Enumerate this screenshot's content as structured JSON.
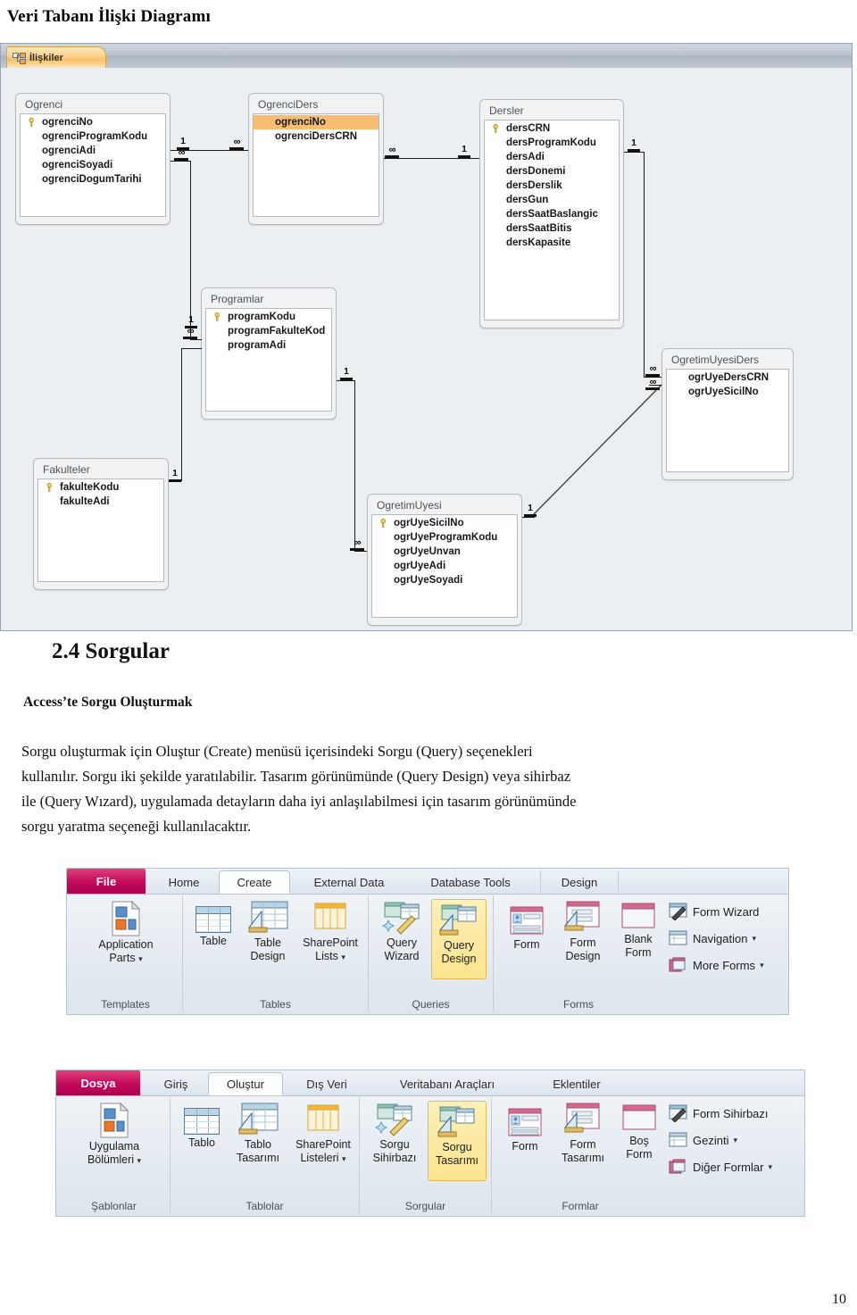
{
  "page": {
    "title": "Veri Tabanı İlişki Diagramı",
    "number": "10"
  },
  "access_window": {
    "tab_label": "İlişkiler",
    "tab_icon": "relationships-icon"
  },
  "er_diagram": {
    "tables": [
      {
        "name": "Ogrenci",
        "fields": [
          {
            "label": "ogrenciNo",
            "key": true,
            "selected": false
          },
          {
            "label": "ogrenciProgramKodu",
            "key": false,
            "selected": false
          },
          {
            "label": "ogrenciAdi",
            "key": false,
            "selected": false
          },
          {
            "label": "ogrenciSoyadi",
            "key": false,
            "selected": false
          },
          {
            "label": "ogrenciDogumTarihi",
            "key": false,
            "selected": false
          }
        ]
      },
      {
        "name": "OgrenciDers",
        "fields": [
          {
            "label": "ogrenciNo",
            "key": false,
            "selected": true
          },
          {
            "label": "ogrenciDersCRN",
            "key": false,
            "selected": false
          }
        ]
      },
      {
        "name": "Dersler",
        "fields": [
          {
            "label": "dersCRN",
            "key": true,
            "selected": false
          },
          {
            "label": "dersProgramKodu",
            "key": false,
            "selected": false
          },
          {
            "label": "dersAdi",
            "key": false,
            "selected": false
          },
          {
            "label": "dersDonemi",
            "key": false,
            "selected": false
          },
          {
            "label": "dersDerslik",
            "key": false,
            "selected": false
          },
          {
            "label": "dersGun",
            "key": false,
            "selected": false
          },
          {
            "label": "dersSaatBaslangic",
            "key": false,
            "selected": false
          },
          {
            "label": "dersSaatBitis",
            "key": false,
            "selected": false
          },
          {
            "label": "dersKapasite",
            "key": false,
            "selected": false
          }
        ]
      },
      {
        "name": "Programlar",
        "fields": [
          {
            "label": "programKodu",
            "key": true,
            "selected": false
          },
          {
            "label": "programFakulteKod",
            "key": false,
            "selected": false
          },
          {
            "label": "programAdi",
            "key": false,
            "selected": false
          }
        ]
      },
      {
        "name": "OgretimUyesiDers",
        "fields": [
          {
            "label": "ogrUyeDersCRN",
            "key": false,
            "selected": false
          },
          {
            "label": "ogrUyeSicilNo",
            "key": false,
            "selected": false
          }
        ]
      },
      {
        "name": "Fakulteler",
        "fields": [
          {
            "label": "fakulteKodu",
            "key": true,
            "selected": false
          },
          {
            "label": "fakulteAdi",
            "key": false,
            "selected": false
          }
        ]
      },
      {
        "name": "OgretimUyesi",
        "fields": [
          {
            "label": "ogrUyeSicilNo",
            "key": true,
            "selected": false
          },
          {
            "label": "ogrUyeProgramKodu",
            "key": false,
            "selected": false
          },
          {
            "label": "ogrUyeUnvan",
            "key": false,
            "selected": false
          },
          {
            "label": "ogrUyeAdi",
            "key": false,
            "selected": false
          },
          {
            "label": "ogrUyeSoyadi",
            "key": false,
            "selected": false
          }
        ]
      }
    ],
    "cardinality_one": "1",
    "cardinality_many": "∞",
    "relationships": [
      {
        "from": "Ogrenci.ogrenciNo",
        "to": "OgrenciDers.ogrenciNo",
        "from_card": "1",
        "to_card": "∞"
      },
      {
        "from": "OgrenciDers.ogrenciDersCRN",
        "to": "Dersler.dersCRN",
        "from_card": "∞",
        "to_card": "1"
      },
      {
        "from": "Programlar.programKodu",
        "to": "Ogrenci.ogrenciProgramKodu",
        "from_card": "1",
        "to_card": "∞"
      },
      {
        "from": "Fakulteler.fakulteKodu",
        "to": "Programlar.programFakulteKod",
        "from_card": "1",
        "to_card": "∞"
      },
      {
        "from": "Programlar.programKodu",
        "to": "OgretimUyesi.ogrUyeProgramKodu",
        "from_card": "1",
        "to_card": "∞"
      },
      {
        "from": "Dersler.dersCRN",
        "to": "OgretimUyesiDers.ogrUyeDersCRN",
        "from_card": "1",
        "to_card": "∞"
      },
      {
        "from": "OgretimUyesi.ogrUyeSicilNo",
        "to": "OgretimUyesiDers.ogrUyeSicilNo",
        "from_card": "1",
        "to_card": "∞"
      }
    ]
  },
  "section": {
    "heading": "2.4 Sorgular",
    "subheading": "Access’te Sorgu Oluşturmak",
    "paragraph_lines": [
      "Sorgu oluşturmak için Oluştur (Create) menüsü içerisindeki Sorgu (Query) seçenekleri",
      "kullanılır. Sorgu iki şekilde yaratılabilir. Tasarım görünümünde (Query Design) veya sihirbaz",
      "ile (Query Wızard), uygulamada detayların daha iyi anlaşılabilmesi için tasarım görünümünde",
      "sorgu yaratma seçeneği kullanılacaktır."
    ]
  },
  "ribbon_en": {
    "tabs": [
      {
        "label": "File",
        "kind": "file"
      },
      {
        "label": "Home",
        "kind": "normal"
      },
      {
        "label": "Create",
        "kind": "active"
      },
      {
        "label": "External Data",
        "kind": "normal"
      },
      {
        "label": "Database Tools",
        "kind": "normal"
      },
      {
        "label": "Design",
        "kind": "contextual"
      }
    ],
    "groups": [
      {
        "label": "Templates",
        "buttons": [
          {
            "label_line1": "Application",
            "label_line2": "Parts",
            "icon": "application-parts-icon",
            "dropdown": true,
            "highlighted": false
          }
        ]
      },
      {
        "label": "Tables",
        "buttons": [
          {
            "label_line1": "Table",
            "label_line2": "",
            "icon": "table-icon",
            "dropdown": false,
            "highlighted": false
          },
          {
            "label_line1": "Table",
            "label_line2": "Design",
            "icon": "table-design-icon",
            "dropdown": false,
            "highlighted": false
          },
          {
            "label_line1": "SharePoint",
            "label_line2": "Lists",
            "icon": "sharepoint-lists-icon",
            "dropdown": true,
            "highlighted": false
          }
        ]
      },
      {
        "label": "Queries",
        "buttons": [
          {
            "label_line1": "Query",
            "label_line2": "Wizard",
            "icon": "query-wizard-icon",
            "dropdown": false,
            "highlighted": false
          },
          {
            "label_line1": "Query",
            "label_line2": "Design",
            "icon": "query-design-icon",
            "dropdown": false,
            "highlighted": true
          }
        ]
      },
      {
        "label": "Forms",
        "buttons": [
          {
            "label_line1": "Form",
            "label_line2": "",
            "icon": "form-icon",
            "dropdown": false,
            "highlighted": false
          },
          {
            "label_line1": "Form",
            "label_line2": "Design",
            "icon": "form-design-icon",
            "dropdown": false,
            "highlighted": false
          },
          {
            "label_line1": "Blank",
            "label_line2": "Form",
            "icon": "blank-form-icon",
            "dropdown": false,
            "highlighted": false
          }
        ],
        "small_buttons": [
          {
            "label": "Form Wizard",
            "icon": "form-wizard-icon",
            "dropdown": false
          },
          {
            "label": "Navigation",
            "icon": "navigation-icon",
            "dropdown": true
          },
          {
            "label": "More Forms",
            "icon": "more-forms-icon",
            "dropdown": true
          }
        ]
      }
    ]
  },
  "ribbon_tr": {
    "tabs": [
      {
        "label": "Dosya",
        "kind": "file"
      },
      {
        "label": "Giriş",
        "kind": "normal"
      },
      {
        "label": "Oluştur",
        "kind": "active"
      },
      {
        "label": "Dış Veri",
        "kind": "normal"
      },
      {
        "label": "Veritabanı Araçları",
        "kind": "normal"
      },
      {
        "label": "Eklentiler",
        "kind": "normal"
      }
    ],
    "groups": [
      {
        "label": "Şablonlar",
        "buttons": [
          {
            "label_line1": "Uygulama",
            "label_line2": "Bölümleri",
            "icon": "application-parts-icon",
            "dropdown": true,
            "highlighted": false
          }
        ]
      },
      {
        "label": "Tablolar",
        "buttons": [
          {
            "label_line1": "Tablo",
            "label_line2": "",
            "icon": "table-icon",
            "dropdown": false,
            "highlighted": false
          },
          {
            "label_line1": "Tablo",
            "label_line2": "Tasarımı",
            "icon": "table-design-icon",
            "dropdown": false,
            "highlighted": false
          },
          {
            "label_line1": "SharePoint",
            "label_line2": "Listeleri",
            "icon": "sharepoint-lists-icon",
            "dropdown": true,
            "highlighted": false
          }
        ]
      },
      {
        "label": "Sorgular",
        "buttons": [
          {
            "label_line1": "Sorgu",
            "label_line2": "Sihirbazı",
            "icon": "query-wizard-icon",
            "dropdown": false,
            "highlighted": false
          },
          {
            "label_line1": "Sorgu",
            "label_line2": "Tasarımı",
            "icon": "query-design-icon",
            "dropdown": false,
            "highlighted": true
          }
        ]
      },
      {
        "label": "Formlar",
        "buttons": [
          {
            "label_line1": "Form",
            "label_line2": "",
            "icon": "form-icon",
            "dropdown": false,
            "highlighted": false
          },
          {
            "label_line1": "Form",
            "label_line2": "Tasarımı",
            "icon": "form-design-icon",
            "dropdown": false,
            "highlighted": false
          },
          {
            "label_line1": "Boş",
            "label_line2": "Form",
            "icon": "blank-form-icon",
            "dropdown": false,
            "highlighted": false
          }
        ],
        "small_buttons": [
          {
            "label": "Form Sihirbazı",
            "icon": "form-wizard-icon",
            "dropdown": false
          },
          {
            "label": "Gezinti",
            "icon": "navigation-icon",
            "dropdown": true
          },
          {
            "label": "Diğer Formlar",
            "icon": "more-forms-icon",
            "dropdown": true
          }
        ]
      }
    ]
  },
  "colors": {
    "file_tab": "#c2095a",
    "highlight": "#fbe48e",
    "selected_field": "#f7bd72",
    "canvas": "#eceff1"
  }
}
